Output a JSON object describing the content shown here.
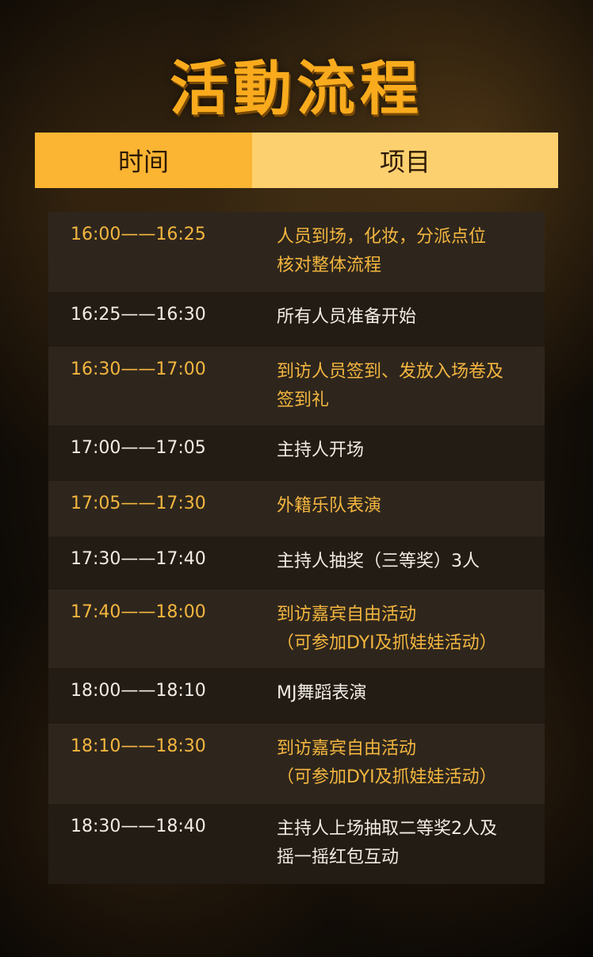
{
  "title": "活動流程",
  "header": {
    "time_label": "时间",
    "item_label": "项目"
  },
  "rows": [
    {
      "time": "16:00——16:25",
      "desc": "人员到场，化妆，分派点位\n核对整体流程"
    },
    {
      "time": "16:25——16:30",
      "desc": "所有人员准备开始"
    },
    {
      "time": "16:30——17:00",
      "desc": "到访人员签到、发放入场卷及\n签到礼"
    },
    {
      "time": "17:00——17:05",
      "desc": "主持人开场"
    },
    {
      "time": "17:05——17:30",
      "desc": "外籍乐队表演"
    },
    {
      "time": "17:30——17:40",
      "desc": "主持人抽奖（三等奖）3人"
    },
    {
      "time": "17:40——18:00",
      "desc": "到访嘉宾自由活动\n（可参加DYI及抓娃娃活动）"
    },
    {
      "time": "18:00——18:10",
      "desc": "MJ舞蹈表演"
    },
    {
      "time": "18:10——18:30",
      "desc": "到访嘉宾自由活动\n（可参加DYI及抓娃娃活动）"
    },
    {
      "time": "18:30——18:40",
      "desc": "主持人上场抽取二等奖2人及\n摇一摇红包互动"
    }
  ],
  "colors": {
    "accent_gold": "#f4b63f",
    "header_left": "#fbb533",
    "header_right": "#fdd06f",
    "title": "#f9ab1d"
  }
}
